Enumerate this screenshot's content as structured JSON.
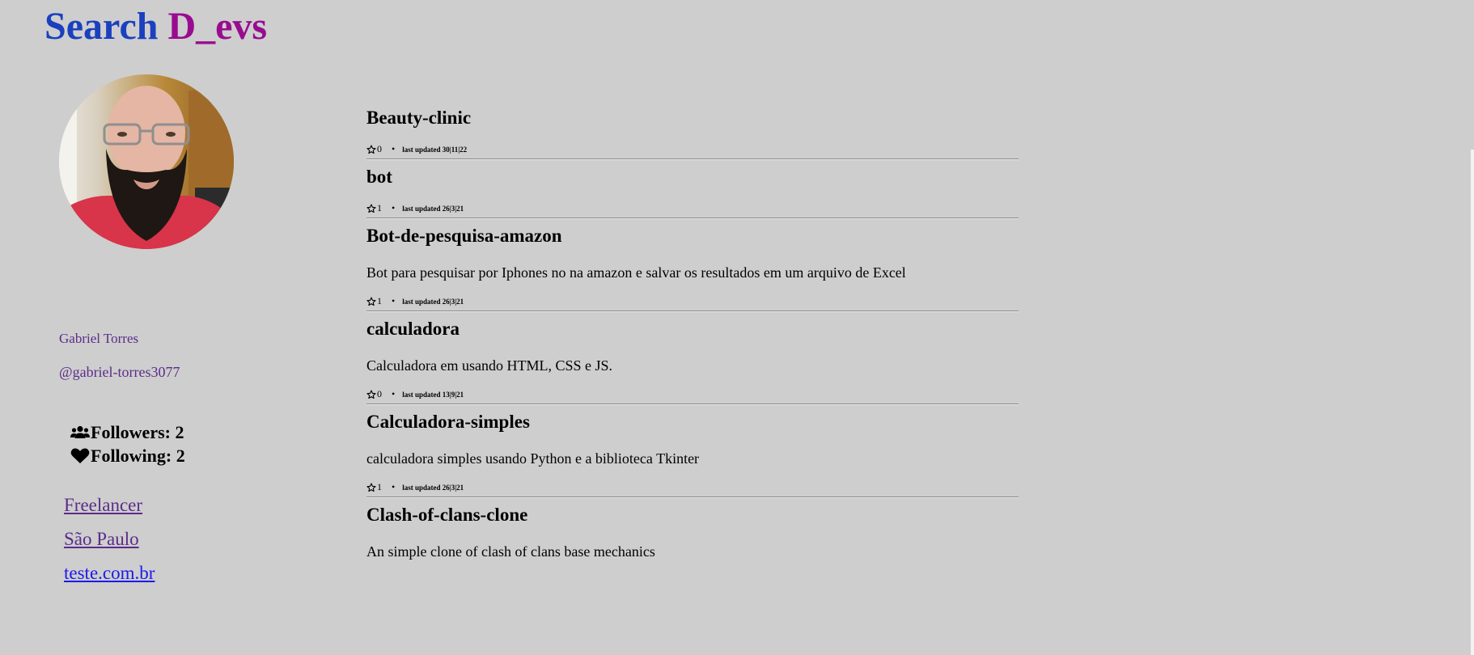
{
  "header": {
    "title_part1": "Search",
    "title_part2": "D_evs",
    "colors": {
      "part1": "#1a3fbf",
      "part2": "#980c90"
    }
  },
  "profile": {
    "avatar_icon": "user-photo",
    "name": "Gabriel Torres",
    "handle": "@gabriel-torres3077",
    "followers_label": "Followers: 2",
    "following_label": "Following: 2",
    "followers_icon": "users-icon",
    "following_icon": "heart-icon",
    "links": {
      "company": "Freelancer",
      "location": "São Paulo",
      "website": "teste.com.br"
    }
  },
  "repos": [
    {
      "name": "Beauty-clinic",
      "description": "",
      "stars": "0",
      "updated": "last updated 30|11|22"
    },
    {
      "name": "bot",
      "description": "",
      "stars": "1",
      "updated": "last updated 26|3|21"
    },
    {
      "name": "Bot-de-pesquisa-amazon",
      "description": "Bot para pesquisar por Iphones no na amazon e salvar os resultados em um arquivo de Excel",
      "stars": "1",
      "updated": "last updated 26|3|21"
    },
    {
      "name": "calculadora",
      "description": "Calculadora em usando HTML, CSS e JS.",
      "stars": "0",
      "updated": "last updated 13|9|21"
    },
    {
      "name": "Calculadora-simples",
      "description": "calculadora simples usando Python e a biblioteca Tkinter",
      "stars": "1",
      "updated": "last updated 26|3|21"
    },
    {
      "name": "Clash-of-clans-clone",
      "description": "An simple clone of clash of clans base mechanics",
      "stars": "",
      "updated": ""
    }
  ],
  "repo_meta": {
    "star_icon": "star-outline-icon",
    "separator": "•"
  }
}
